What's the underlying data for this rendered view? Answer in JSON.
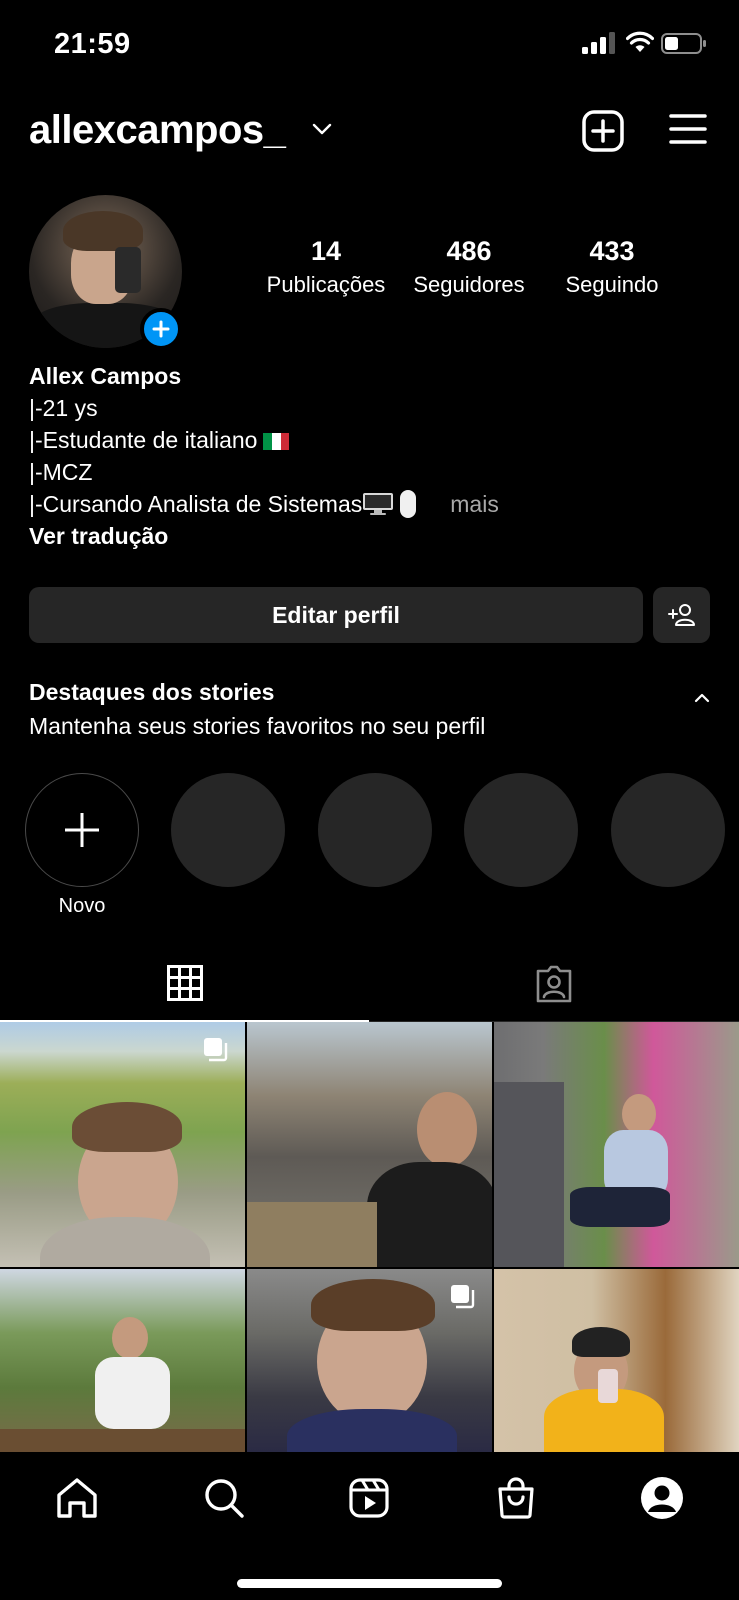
{
  "status_bar": {
    "time": "21:59"
  },
  "header": {
    "username": "allexcampos_"
  },
  "profile": {
    "stats": [
      {
        "value": "14",
        "label": "Publicações"
      },
      {
        "value": "486",
        "label": "Seguidores"
      },
      {
        "value": "433",
        "label": "Seguindo"
      }
    ],
    "name": "Allex Campos",
    "bio_lines": [
      "|-21 ys",
      "|-Estudante de italiano",
      "|-MCZ",
      "|-Cursando Analista de Sistemas"
    ],
    "more_label": "mais",
    "translate_label": "Ver tradução"
  },
  "actions": {
    "edit_profile_label": "Editar perfil"
  },
  "highlights": {
    "title": "Destaques dos stories",
    "subtitle": "Mantenha seus stories favoritos no seu perfil",
    "new_label": "Novo"
  },
  "colors": {
    "accent_blue": "#0095f6",
    "button_bg": "#262626",
    "muted_text": "#a8a8a8"
  },
  "icons": {
    "header": [
      "chevron-down-icon",
      "add-post-icon",
      "menu-icon"
    ],
    "tabs": [
      "grid-icon",
      "tagged-icon"
    ],
    "bottom_nav": [
      "home-icon",
      "search-icon",
      "reels-icon",
      "shop-icon",
      "profile-icon"
    ]
  }
}
